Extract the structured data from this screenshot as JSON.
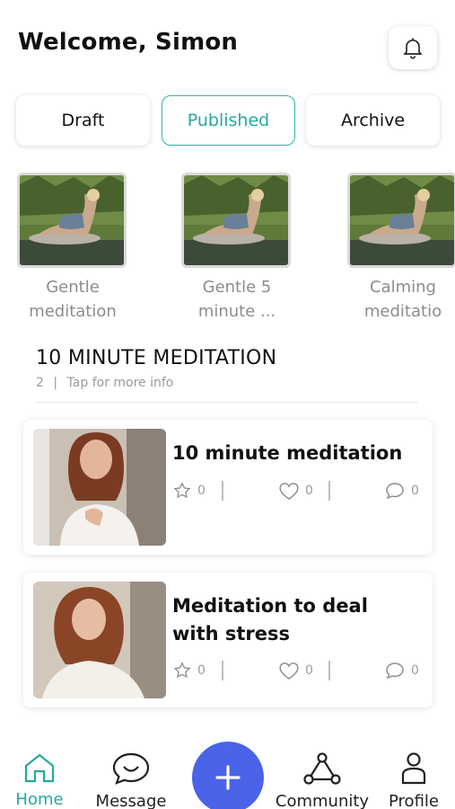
{
  "header": {
    "title": "Welcome, Simon",
    "bell_icon": "bell-icon"
  },
  "tabs": [
    {
      "label": "Draft",
      "active": false
    },
    {
      "label": "Published",
      "active": true
    },
    {
      "label": "Archive",
      "active": false
    }
  ],
  "drafts": [
    {
      "title_line1": "Gentle",
      "title_line2": "meditation"
    },
    {
      "title_line1": "Gentle 5",
      "title_line2": "minute ..."
    },
    {
      "title_line1": "Calming",
      "title_line2": "meditatio"
    }
  ],
  "playlist": {
    "title": "10 MINUTE MEDITATION",
    "count": "2",
    "separator": "|",
    "hint": "Tap for more info"
  },
  "videos": [
    {
      "title_line1": "10 minute meditation",
      "title_line2": "",
      "stars": "0",
      "likes": "0",
      "comments": "0"
    },
    {
      "title_line1": "Meditation to deal",
      "title_line2": "with stress",
      "stars": "0",
      "likes": "0",
      "comments": "0"
    }
  ],
  "bottom_nav": {
    "home": "Home",
    "message": "Message",
    "community": "Community",
    "profile": "Profile"
  },
  "colors": {
    "accent": "#26a99e",
    "fab": "#4a63e8"
  }
}
